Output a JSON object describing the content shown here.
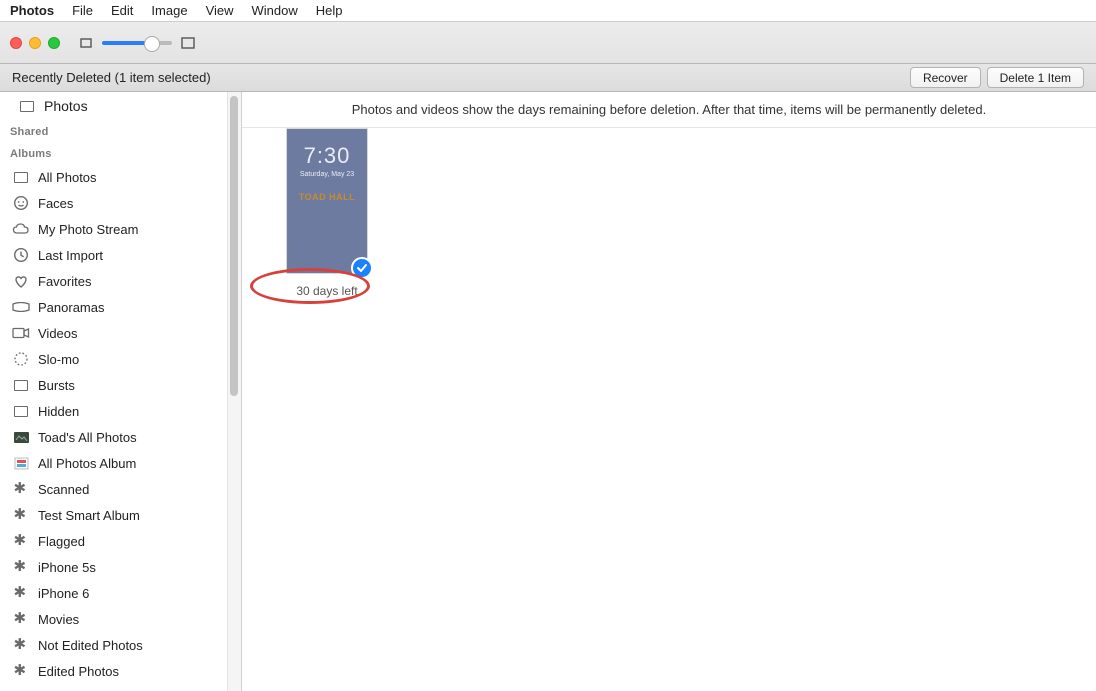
{
  "menubar": {
    "app": "Photos",
    "items": [
      "File",
      "Edit",
      "Image",
      "View",
      "Window",
      "Help"
    ]
  },
  "toolbar": {
    "zoom_percent": 65
  },
  "actionbar": {
    "title": "Recently Deleted (1 item selected)",
    "recover_label": "Recover",
    "delete_label": "Delete 1 Item"
  },
  "sidebar": {
    "photos_label": "Photos",
    "shared_header": "Shared",
    "albums_header": "Albums",
    "albums": [
      {
        "label": "All Photos",
        "icon": "rect"
      },
      {
        "label": "Faces",
        "icon": "face"
      },
      {
        "label": "My Photo Stream",
        "icon": "cloud"
      },
      {
        "label": "Last Import",
        "icon": "clock"
      },
      {
        "label": "Favorites",
        "icon": "heart"
      },
      {
        "label": "Panoramas",
        "icon": "pano"
      },
      {
        "label": "Videos",
        "icon": "video"
      },
      {
        "label": "Slo-mo",
        "icon": "slomo"
      },
      {
        "label": "Bursts",
        "icon": "rect"
      },
      {
        "label": "Hidden",
        "icon": "rect"
      },
      {
        "label": "Toad's All Photos",
        "icon": "album"
      },
      {
        "label": "All Photos Album",
        "icon": "album2"
      },
      {
        "label": "Scanned",
        "icon": "gear"
      },
      {
        "label": "Test Smart Album",
        "icon": "gear"
      },
      {
        "label": "Flagged",
        "icon": "gear"
      },
      {
        "label": "iPhone 5s",
        "icon": "gear"
      },
      {
        "label": "iPhone 6",
        "icon": "gear"
      },
      {
        "label": "Movies",
        "icon": "gear"
      },
      {
        "label": "Not Edited Photos",
        "icon": "gear"
      },
      {
        "label": "Edited Photos",
        "icon": "gear"
      }
    ]
  },
  "content": {
    "info_text": "Photos and videos show the days remaining before deletion. After that time, items will be permanently deleted.",
    "item": {
      "time": "7:30",
      "date": "Saturday, May 23",
      "poster_text": "TOAD HALL",
      "days_left_label": "30 days left",
      "selected": true
    }
  }
}
